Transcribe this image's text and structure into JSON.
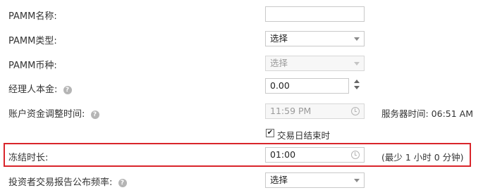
{
  "form": {
    "pamm_name": {
      "label": "PAMM名称:",
      "value": ""
    },
    "pamm_type": {
      "label": "PAMM类型:",
      "value": "选择"
    },
    "pamm_currency": {
      "label": "PAMM币种:",
      "value": "选择"
    },
    "manager_capital": {
      "label": "经理人本金:",
      "value": "0.00"
    },
    "adjust_time": {
      "label": "账户资金调整时间:",
      "value": "11:59 PM",
      "server_time": "服务器时间: 06:51 AM"
    },
    "trading_day_end": {
      "label": "交易日结束时",
      "checked": true
    },
    "freeze_duration": {
      "label": "冻结时长:",
      "value": "01:00",
      "hint": "(最少 1 小时 0 分钟)"
    },
    "report_frequency": {
      "label": "投资者交易报告公布频率:",
      "value": "选择"
    }
  },
  "icons": {
    "help": "?",
    "check": "✔"
  },
  "colors": {
    "highlight_border": "#d9252b"
  }
}
